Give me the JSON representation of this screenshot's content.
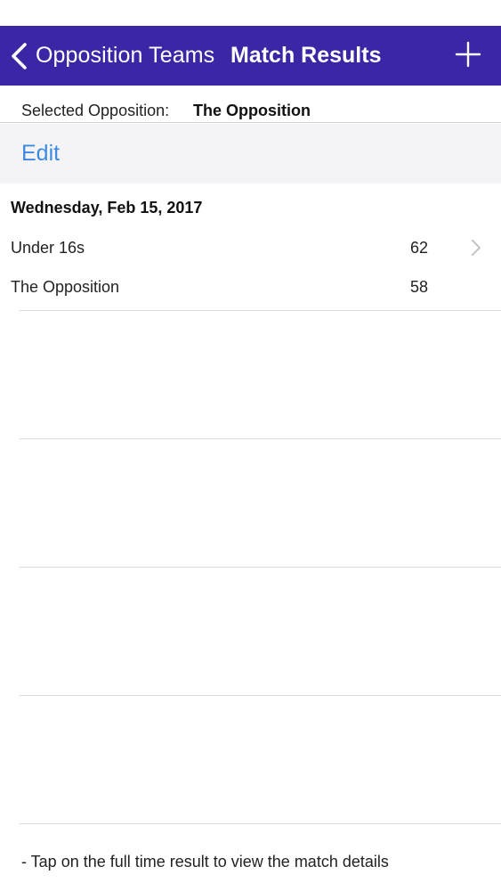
{
  "nav": {
    "back_label": "Opposition Teams",
    "title": "Match Results",
    "back_icon": "chevron-left-icon",
    "add_icon": "plus-icon",
    "background_color": "#3b27a6"
  },
  "selection": {
    "label": "Selected Opposition:",
    "value": "The Opposition"
  },
  "toolbar": {
    "edit_label": "Edit",
    "accent_color": "#3d8ae0"
  },
  "match": {
    "date": "Wednesday, Feb 15, 2017",
    "rows": [
      {
        "team": "Under 16s",
        "score": "62"
      },
      {
        "team": "The Opposition",
        "score": "58"
      }
    ],
    "disclosure_icon": "chevron-right-icon"
  },
  "footer": {
    "note": "- Tap on the full time result to view the match details"
  }
}
